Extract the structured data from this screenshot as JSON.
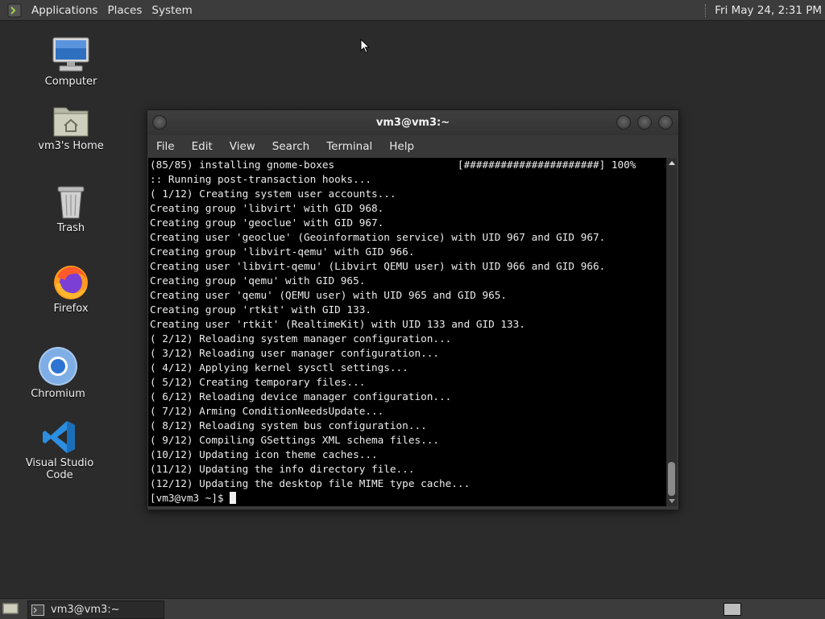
{
  "top_panel": {
    "menus": [
      "Applications",
      "Places",
      "System"
    ],
    "clock": "Fri May 24,  2:31 PM"
  },
  "desktop_icons": [
    {
      "label": "Computer",
      "icon": "computer-icon"
    },
    {
      "label": "vm3's Home",
      "icon": "home-folder-icon"
    },
    {
      "label": "Trash",
      "icon": "trash-icon"
    },
    {
      "label": "Firefox",
      "icon": "firefox-icon"
    },
    {
      "label": "Chromium",
      "icon": "chromium-icon"
    },
    {
      "label": "Visual Studio Code",
      "icon": "vscode-icon"
    }
  ],
  "terminal": {
    "title": "vm3@vm3:~",
    "menus": [
      "File",
      "Edit",
      "View",
      "Search",
      "Terminal",
      "Help"
    ],
    "lines": [
      "(85/85) installing gnome-boxes                    [######################] 100%",
      ":: Running post-transaction hooks...",
      "( 1/12) Creating system user accounts...",
      "Creating group 'libvirt' with GID 968.",
      "Creating group 'geoclue' with GID 967.",
      "Creating user 'geoclue' (Geoinformation service) with UID 967 and GID 967.",
      "Creating group 'libvirt-qemu' with GID 966.",
      "Creating user 'libvirt-qemu' (Libvirt QEMU user) with UID 966 and GID 966.",
      "Creating group 'qemu' with GID 965.",
      "Creating user 'qemu' (QEMU user) with UID 965 and GID 965.",
      "Creating group 'rtkit' with GID 133.",
      "Creating user 'rtkit' (RealtimeKit) with UID 133 and GID 133.",
      "( 2/12) Reloading system manager configuration...",
      "( 3/12) Reloading user manager configuration...",
      "( 4/12) Applying kernel sysctl settings...",
      "( 5/12) Creating temporary files...",
      "( 6/12) Reloading device manager configuration...",
      "( 7/12) Arming ConditionNeedsUpdate...",
      "( 8/12) Reloading system bus configuration...",
      "( 9/12) Compiling GSettings XML schema files...",
      "(10/12) Updating icon theme caches...",
      "(11/12) Updating the info directory file...",
      "(12/12) Updating the desktop file MIME type cache..."
    ],
    "prompt": "[vm3@vm3 ~]$ "
  },
  "taskbar": {
    "window_button": "vm3@vm3:~"
  },
  "colors": {
    "desktop_bg": "#2b2b2b",
    "panel_bg": "#3c3c3c",
    "terminal_bg": "#000000",
    "terminal_fg": "#ececec"
  }
}
